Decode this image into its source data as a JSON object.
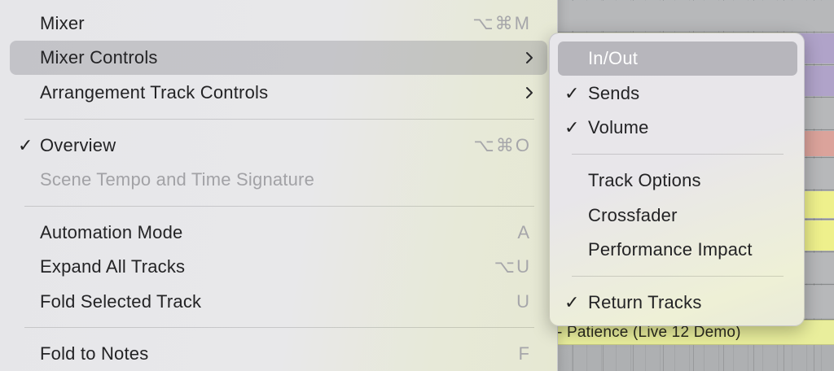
{
  "main_menu": {
    "items": [
      {
        "label": "Mixer",
        "shortcut": "⌥⌘M",
        "checked": false,
        "disabled": false,
        "highlighted": false,
        "submenu": false
      },
      {
        "label": "Mixer Controls",
        "shortcut": "",
        "checked": false,
        "disabled": false,
        "highlighted": true,
        "submenu": true
      },
      {
        "label": "Arrangement Track Controls",
        "shortcut": "",
        "checked": false,
        "disabled": false,
        "highlighted": false,
        "submenu": true
      },
      {
        "label": "Overview",
        "shortcut": "⌥⌘O",
        "checked": true,
        "disabled": false,
        "highlighted": false,
        "submenu": false
      },
      {
        "label": "Scene Tempo and Time Signature",
        "shortcut": "",
        "checked": false,
        "disabled": true,
        "highlighted": false,
        "submenu": false
      },
      {
        "label": "Automation Mode",
        "shortcut": "A",
        "checked": false,
        "disabled": false,
        "highlighted": false,
        "submenu": false
      },
      {
        "label": "Expand All Tracks",
        "shortcut": "⌥U",
        "checked": false,
        "disabled": false,
        "highlighted": false,
        "submenu": false
      },
      {
        "label": "Fold Selected Track",
        "shortcut": "U",
        "checked": false,
        "disabled": false,
        "highlighted": false,
        "submenu": false
      },
      {
        "label": "Fold to Notes",
        "shortcut": "F",
        "checked": false,
        "disabled": false,
        "highlighted": false,
        "submenu": false
      }
    ],
    "check_glyph": "✓"
  },
  "submenu": {
    "items": [
      {
        "label": "In/Out",
        "checked": false,
        "highlighted": true
      },
      {
        "label": "Sends",
        "checked": true,
        "highlighted": false
      },
      {
        "label": "Volume",
        "checked": true,
        "highlighted": false
      },
      {
        "label": "Track Options",
        "checked": false,
        "highlighted": false
      },
      {
        "label": "Crossfader",
        "checked": false,
        "highlighted": false
      },
      {
        "label": "Performance Impact",
        "checked": false,
        "highlighted": false
      },
      {
        "label": "Return Tracks",
        "checked": true,
        "highlighted": false
      }
    ],
    "check_glyph": "✓"
  },
  "arrangement": {
    "clip_label": "- Patience (Live 12 Demo)",
    "lane_colors": [
      "#b7b8ba",
      "#b0a3c9",
      "#b7b8ba",
      "#dba39b",
      "#b7b8ba",
      "#eef08c",
      "#eef08c",
      "#b7b8ba",
      "#b7b8ba"
    ]
  },
  "colors": {
    "highlight": "#8c8c94",
    "text": "#232325",
    "shortcut": "#a6a6aa",
    "disabled": "#a2a2a6"
  }
}
